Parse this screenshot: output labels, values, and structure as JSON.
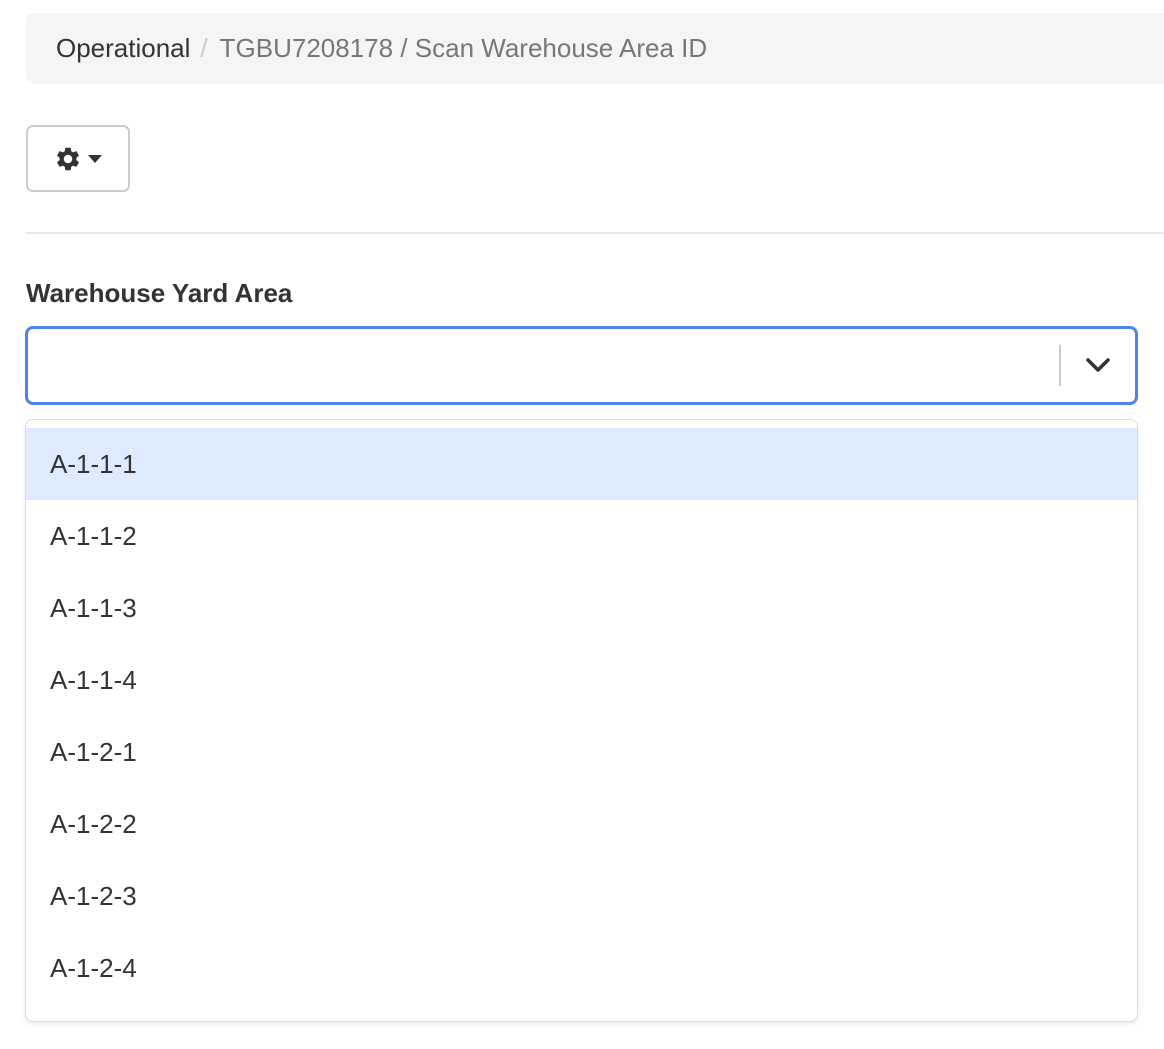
{
  "breadcrumb": {
    "parent": "Operational",
    "separator": "/",
    "current": "TGBU7208178 / Scan Warehouse Area ID"
  },
  "toolbar": {
    "settings_icon": "gear-icon",
    "caret_icon": "caret-down-icon"
  },
  "form": {
    "label": "Warehouse Yard Area",
    "value": "",
    "dropdown_icon": "chevron-down-icon",
    "options": [
      {
        "label": "A-1-1-1",
        "focused": true
      },
      {
        "label": "A-1-1-2",
        "focused": false
      },
      {
        "label": "A-1-1-3",
        "focused": false
      },
      {
        "label": "A-1-1-4",
        "focused": false
      },
      {
        "label": "A-1-2-1",
        "focused": false
      },
      {
        "label": "A-1-2-2",
        "focused": false
      },
      {
        "label": "A-1-2-3",
        "focused": false
      },
      {
        "label": "A-1-2-4",
        "focused": false
      }
    ]
  },
  "colors": {
    "focus_border": "#4a85ea",
    "option_focus_bg": "#deebff",
    "breadcrumb_bg": "#f5f5f5"
  }
}
